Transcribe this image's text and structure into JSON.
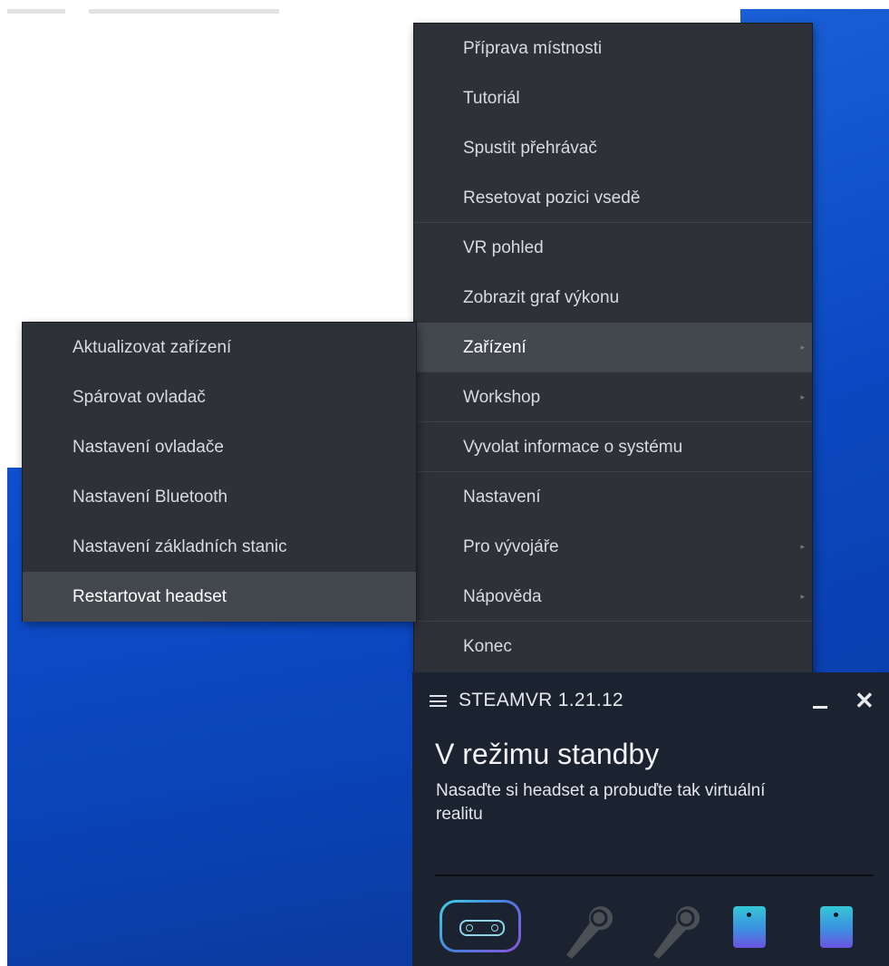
{
  "main_menu": {
    "items": [
      {
        "label": "Příprava místnosti",
        "submenu": false
      },
      {
        "label": "Tutoriál",
        "submenu": false
      },
      {
        "label": "Spustit přehrávač",
        "submenu": false
      },
      {
        "label": "Resetovat pozici vsedě",
        "submenu": false
      },
      {
        "label": "VR pohled",
        "submenu": false
      },
      {
        "label": "Zobrazit graf výkonu",
        "submenu": false
      },
      {
        "label": "Zařízení",
        "submenu": true,
        "highlighted": true
      },
      {
        "label": "Workshop",
        "submenu": true
      },
      {
        "label": "Vyvolat informace o systému",
        "submenu": false
      },
      {
        "label": "Nastavení",
        "submenu": false
      },
      {
        "label": "Pro vývojáře",
        "submenu": true
      },
      {
        "label": "Nápověda",
        "submenu": true
      },
      {
        "label": "Konec",
        "submenu": false
      }
    ],
    "submenu_arrow": "▸"
  },
  "device_submenu": {
    "items": [
      {
        "label": "Aktualizovat zařízení"
      },
      {
        "label": "Spárovat ovladač"
      },
      {
        "label": "Nastavení ovladače"
      },
      {
        "label": "Nastavení Bluetooth"
      },
      {
        "label": "Nastavení základních stanic"
      },
      {
        "label": "Restartovat headset",
        "highlighted": true
      }
    ]
  },
  "steamvr_window": {
    "title": "STEAMVR 1.21.12",
    "close_glyph": "✕",
    "status": "V režimu standby",
    "description": "Nasaďte si headset a probuďte tak virtuální realitu",
    "devices": [
      {
        "type": "headset",
        "icon": "headset-icon"
      },
      {
        "type": "controller",
        "icon": "controller-icon"
      },
      {
        "type": "controller",
        "icon": "controller-icon"
      },
      {
        "type": "tracker",
        "icon": "tracker-icon"
      },
      {
        "type": "tracker",
        "icon": "tracker-icon"
      }
    ]
  },
  "colors": {
    "menu_bg": "#2e3137",
    "menu_highlight": "#43474e",
    "window_bg": "#1b2330",
    "wallpaper_blue": "#0b49c2"
  }
}
